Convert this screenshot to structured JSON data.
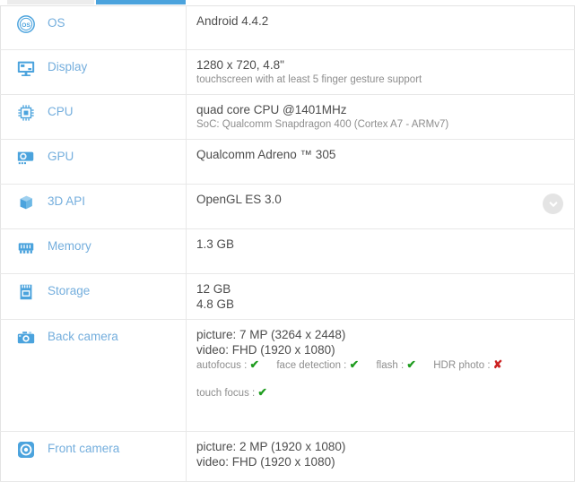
{
  "tabs": {
    "inactive_label": "",
    "active_label": "",
    "accent_color": "#4ba3dd",
    "inactive_color": "#ececec"
  },
  "theme": {
    "label_blue": "#74aedd",
    "value_gray": "#4d4d4d",
    "sub_gray": "#8e8e8e",
    "yes_green": "#1f9c1f",
    "no_red": "#cc2222",
    "border": "#e8e8e8"
  },
  "expand_button": {
    "icon": "chevron-down-icon",
    "label": ""
  },
  "rows": [
    {
      "icon": "os-icon",
      "label": "OS",
      "main": "Android 4.4.2",
      "sub": "",
      "features": [],
      "extra": ""
    },
    {
      "icon": "display-monitor-icon",
      "label": "Display",
      "main": "1280 x 720, 4.8\"",
      "sub": "touchscreen with at least 5 finger gesture support",
      "features": [],
      "extra": ""
    },
    {
      "icon": "cpu-chip-icon",
      "label": "CPU",
      "main": "quad core CPU @1401MHz",
      "sub": "SoC: Qualcomm Snapdragon 400 (Cortex A7 - ARMv7)",
      "features": [],
      "extra": ""
    },
    {
      "icon": "gpu-card-icon",
      "label": "GPU",
      "main": "Qualcomm Adreno ™ 305",
      "sub": "",
      "features": [],
      "extra": ""
    },
    {
      "icon": "cube-3d-icon",
      "label": "3D API",
      "main": "OpenGL ES 3.0",
      "sub": "",
      "features": [],
      "extra": ""
    },
    {
      "icon": "memory-ram-icon",
      "label": "Memory",
      "main": "1.3 GB",
      "sub": "",
      "features": [],
      "extra": ""
    },
    {
      "icon": "storage-card-icon",
      "label": "Storage",
      "main": "12 GB",
      "main2": "4.8 GB",
      "sub": "",
      "features": [],
      "extra": ""
    },
    {
      "icon": "back-camera-icon",
      "label": "Back camera",
      "main": "picture: 7 MP (3264 x 2448)",
      "main2": "video: FHD (1920 x 1080)",
      "features": [
        {
          "name": "autofocus :",
          "value": true
        },
        {
          "name": "face detection :",
          "value": true
        },
        {
          "name": "flash :",
          "value": true
        },
        {
          "name": "HDR photo :",
          "value": false
        }
      ],
      "extra_features": [
        {
          "name": "touch focus :",
          "value": true
        }
      ]
    },
    {
      "icon": "front-camera-icon",
      "label": "Front camera",
      "main": "picture: 2 MP (1920 x 1080)",
      "main2": "video: FHD (1920 x 1080)",
      "features": [],
      "extra": ""
    }
  ],
  "marks": {
    "yes": "✔",
    "no": "✘"
  }
}
